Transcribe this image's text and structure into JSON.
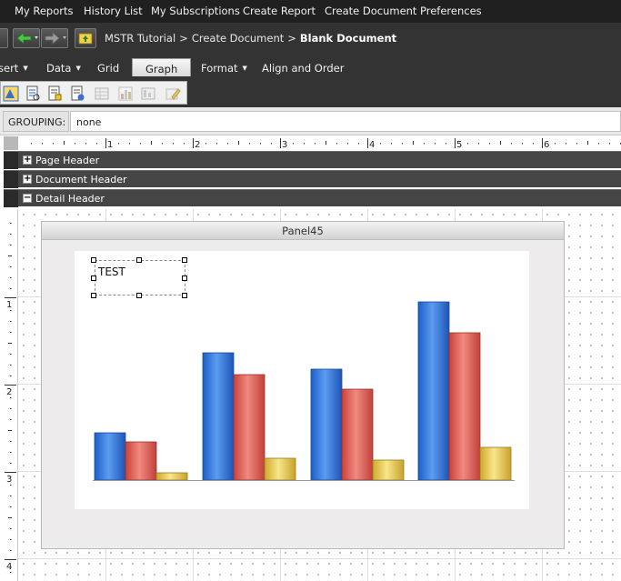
{
  "topnav": {
    "items": [
      "My Reports",
      "History List",
      "My Subscriptions",
      "Create Report",
      "Create Document",
      "Preferences"
    ]
  },
  "breadcrumb": {
    "root": "MSTR Tutorial",
    "parent": "Create Document",
    "current": "Blank Document",
    "separator": ">"
  },
  "ribbon": {
    "menus": [
      "sert",
      "Data",
      "Grid",
      "Graph",
      "Format",
      "Align and Order"
    ],
    "active": "Graph"
  },
  "toolbar": {
    "icons": [
      "graph-style-icon",
      "properties-icon",
      "format-icon",
      "export-icon",
      "grid-icon",
      "bar-chart-icon",
      "table-chart-icon",
      "edit-icon"
    ]
  },
  "grouping": {
    "label": "GROUPING:",
    "value": "none"
  },
  "ruler": {
    "marks": [
      "1",
      "2",
      "3",
      "4",
      "5",
      "6"
    ],
    "vertical_marks": [
      "1",
      "2",
      "3",
      "4"
    ]
  },
  "sections": [
    {
      "title": "Page Header",
      "toggle": "+"
    },
    {
      "title": "Document Header",
      "toggle": "+"
    },
    {
      "title": "Detail Header",
      "toggle": "−"
    }
  ],
  "panel": {
    "title": "Panel45",
    "textbox": "TEST"
  },
  "chart_data": {
    "type": "bar",
    "categories": [
      "",
      "",
      "",
      ""
    ],
    "series": [
      {
        "color": "#3478d8",
        "values": [
          26,
          70,
          61,
          98
        ]
      },
      {
        "color": "#e05c52",
        "values": [
          21,
          58,
          50,
          81
        ]
      },
      {
        "color": "#e8c94a",
        "values": [
          4,
          12,
          11,
          18
        ]
      }
    ],
    "ylim": [
      0,
      100
    ],
    "xlabel": "",
    "ylabel": "",
    "grid": false,
    "legend": "none"
  }
}
